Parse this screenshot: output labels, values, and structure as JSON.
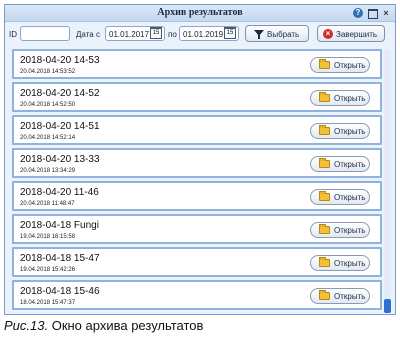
{
  "window": {
    "title": "Архив результатов",
    "help_glyph": "?",
    "close_glyph": "×"
  },
  "toolbar": {
    "id_label": "ID",
    "id_value": "",
    "date_from_label": "Дата с",
    "date_from": "01.01.2017",
    "date_to_label": "по",
    "date_to": "01.01.2019",
    "calendar_glyph": "15",
    "select_label": "Выбрать",
    "finish_label": "Завершить"
  },
  "results": [
    {
      "title": "2018-04-20 14-53",
      "date": "20.04.2018 14:53:52",
      "open_label": "Открыть"
    },
    {
      "title": "2018-04-20 14-52",
      "date": "20.04.2018 14:52:50",
      "open_label": "Открыть"
    },
    {
      "title": "2018-04-20 14-51",
      "date": "20.04.2018 14:52:14",
      "open_label": "Открыть"
    },
    {
      "title": "2018-04-20 13-33",
      "date": "20.04.2018 13:34:29",
      "open_label": "Открыть"
    },
    {
      "title": "2018-04-20 11-46",
      "date": "20.04.2018 11:48:47",
      "open_label": "Открыть"
    },
    {
      "title": "2018-04-18 Fungi",
      "date": "19.04.2018 16:15:58",
      "open_label": "Открыть"
    },
    {
      "title": "2018-04-18 15-47",
      "date": "19.04.2018 15:42:26",
      "open_label": "Открыть"
    },
    {
      "title": "2018-04-18 15-46",
      "date": "18.04.2018 15:47:37",
      "open_label": "Открыть"
    }
  ],
  "caption": {
    "prefix": "Рис.13.",
    "text": " Окно архива результатов"
  }
}
